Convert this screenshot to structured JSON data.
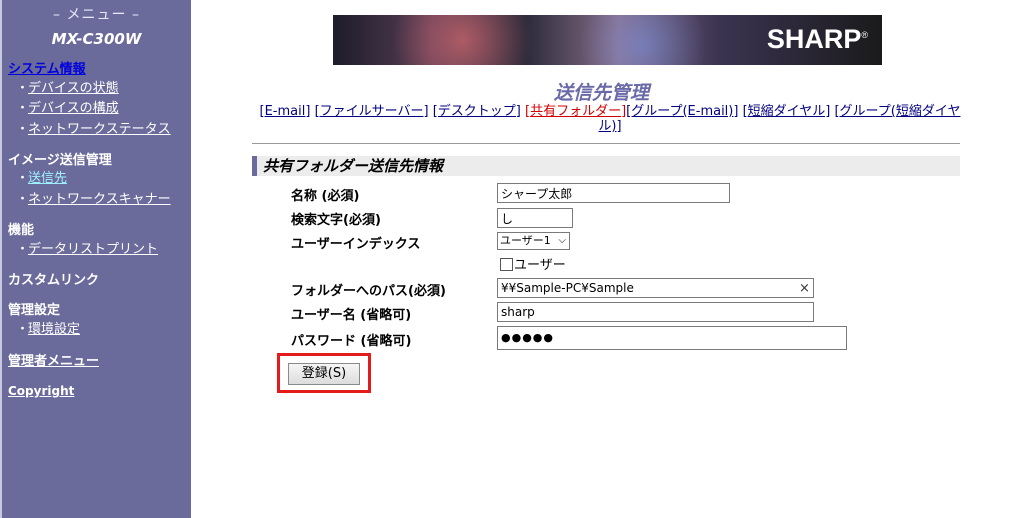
{
  "sidebar": {
    "menu_title": "– メニュー –",
    "model": "MX-C300W",
    "sections": {
      "system_info": "システム情報",
      "image_send": "イメージ送信管理",
      "functions": "機能",
      "custom_link": "カスタムリンク",
      "admin_settings": "管理設定",
      "admin_menu": "管理者メニュー",
      "copyright": "Copyright"
    },
    "items": {
      "device_status": "デバイスの状態",
      "device_config": "デバイスの構成",
      "network_status": "ネットワークステータス",
      "destination": "送信先",
      "network_scanner": "ネットワークスキャナー",
      "data_list_print": "データリストプリント",
      "env_settings": "環境設定"
    },
    "bullet": "・"
  },
  "banner": {
    "logo": "SHARP",
    "logo_mark": "®"
  },
  "page_title": "送信先管理",
  "tabs": [
    "[E-mail]",
    "[ファイルサーバー]",
    "[デスクトップ]",
    "[共有フォルダー]",
    "[グループ(E-mail)]",
    "[短縮ダイヤル]",
    "[グループ(短縮ダイヤル)]"
  ],
  "active_tab": "[共有フォルダー]",
  "section_title": "共有フォルダー送信先情報",
  "form": {
    "name_label": "名称 (必須)",
    "name_value": "シャープ太郎",
    "search_label": "検索文字(必須)",
    "search_value": "し",
    "user_index_label": "ユーザーインデックス",
    "user_index_value": "ユーザー1",
    "user_checkbox_label": "ユーザー",
    "user_checkbox_checked": false,
    "path_label": "フォルダーへのパス(必須)",
    "path_value": "¥¥Sample-PC¥Sample",
    "clear_icon": "×",
    "username_label": "ユーザー名 (省略可)",
    "username_value": "sharp",
    "password_label": "パスワード (省略可)",
    "password_value": "●●●●●",
    "register_button": "登録(S)"
  },
  "colors": {
    "sidebar_bg": "#6b6b9b",
    "title_color": "#6a6aa8",
    "active_tab": "#d20000",
    "highlight": "#e41b1b"
  }
}
